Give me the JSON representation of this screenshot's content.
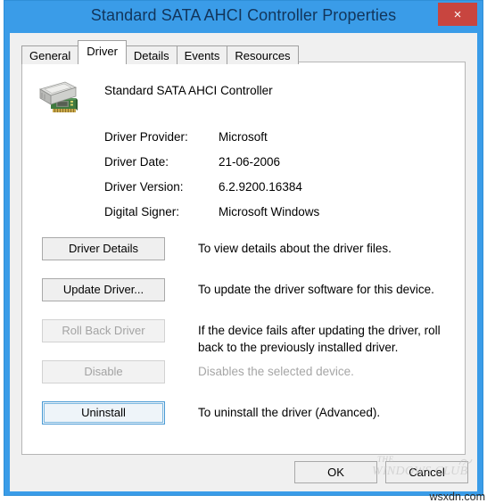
{
  "window": {
    "title": "Standard SATA AHCI Controller Properties",
    "close_label": "×",
    "titlebar_color": "#3a9ce8",
    "close_color": "#c8453f"
  },
  "tabs": [
    {
      "label": "General",
      "active": false
    },
    {
      "label": "Driver",
      "active": true
    },
    {
      "label": "Details",
      "active": false
    },
    {
      "label": "Events",
      "active": false
    },
    {
      "label": "Resources",
      "active": false
    }
  ],
  "device": {
    "name": "Standard SATA AHCI Controller",
    "icon": "sata-controller-icon"
  },
  "driver_info": [
    {
      "label": "Driver Provider:",
      "value": "Microsoft"
    },
    {
      "label": "Driver Date:",
      "value": "21-06-2006"
    },
    {
      "label": "Driver Version:",
      "value": "6.2.9200.16384"
    },
    {
      "label": "Digital Signer:",
      "value": "Microsoft Windows"
    }
  ],
  "actions": [
    {
      "name": "driver-details",
      "label": "Driver Details",
      "description": "To view details about the driver files.",
      "enabled": true,
      "focused": false
    },
    {
      "name": "update-driver",
      "label": "Update Driver...",
      "description": "To update the driver software for this device.",
      "enabled": true,
      "focused": false
    },
    {
      "name": "roll-back-driver",
      "label": "Roll Back Driver",
      "description": "If the device fails after updating the driver, roll back to the previously installed driver.",
      "enabled": false,
      "focused": false
    },
    {
      "name": "disable",
      "label": "Disable",
      "description": "Disables the selected device.",
      "enabled": false,
      "focused": false
    },
    {
      "name": "uninstall",
      "label": "Uninstall",
      "description": "To uninstall the driver (Advanced).",
      "enabled": true,
      "focused": true
    }
  ],
  "footer": {
    "ok_label": "OK",
    "cancel_label": "Cancel"
  },
  "watermark": {
    "line1": "THE",
    "line2": "WINDOWS CLUB"
  },
  "site_footer": {
    "text": "wsxdn.com"
  }
}
